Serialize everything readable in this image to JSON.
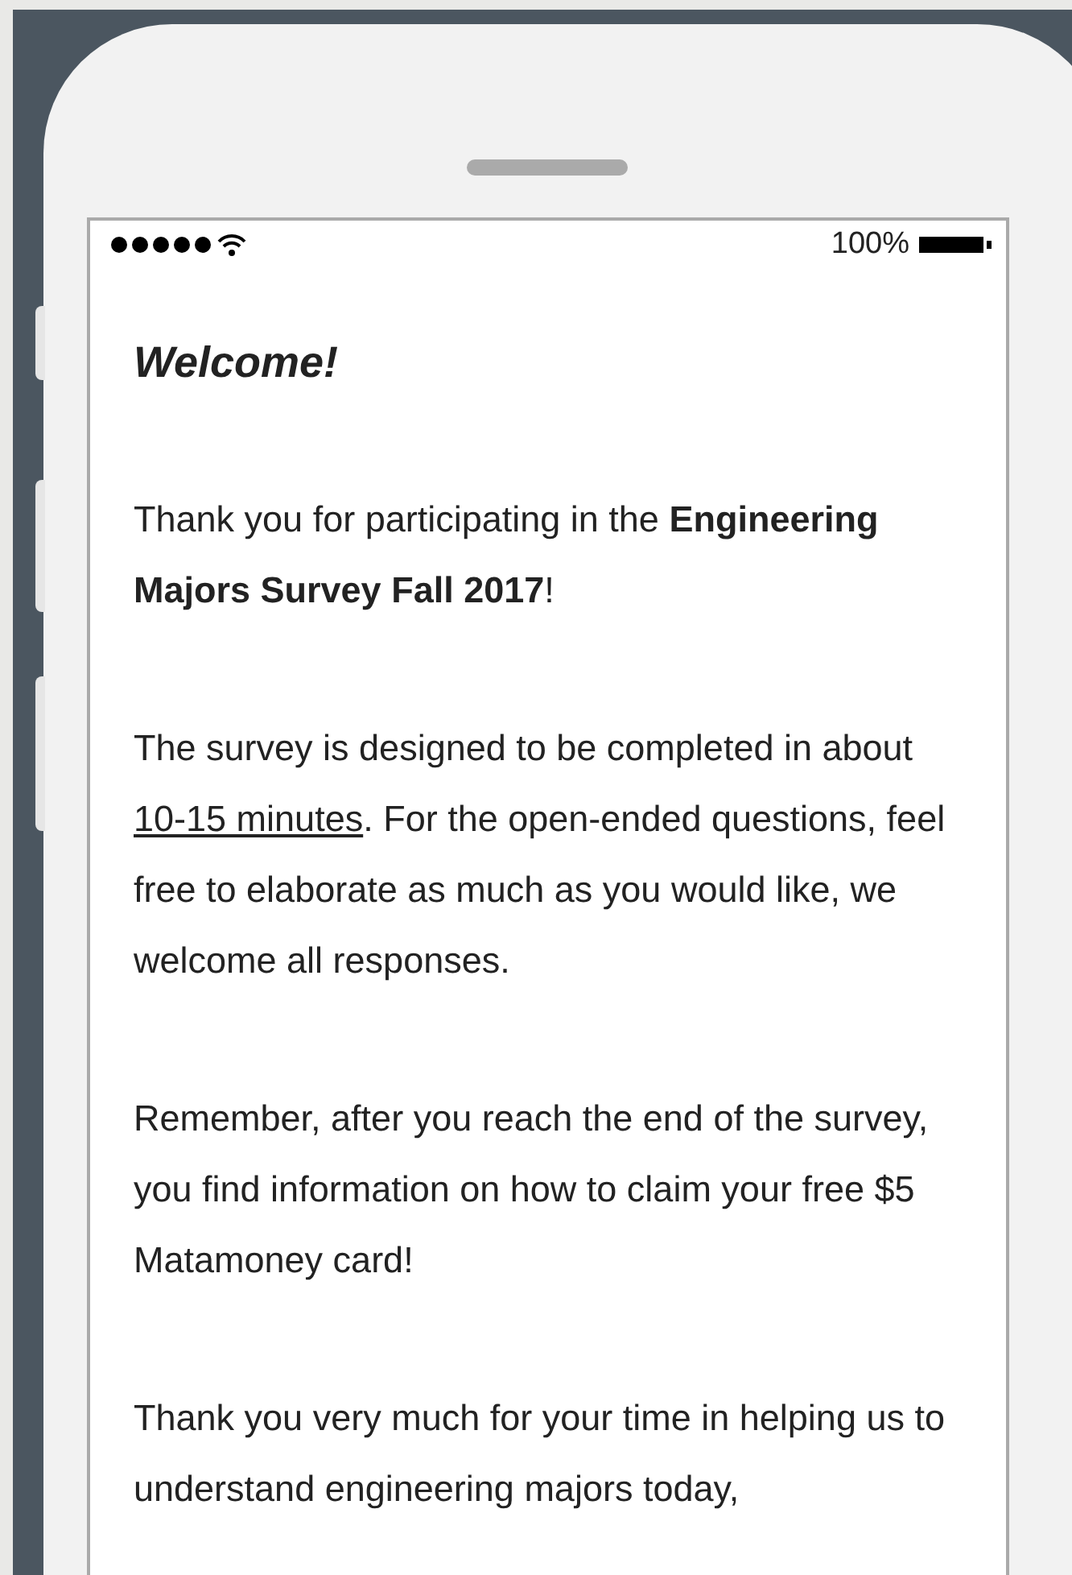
{
  "status_bar": {
    "battery_percent": "100%"
  },
  "title": "Welcome!",
  "paragraphs": [
    {
      "segments": [
        {
          "text": "Thank you for participating in the **Engineering Majors Survey Fall 2017**!",
          "underline": false
        }
      ]
    },
    {
      "segments": [
        {
          "text": "The survey is designed to be completed in about ",
          "underline": false
        },
        {
          "text": "10-15 minutes",
          "underline": true
        },
        {
          "text": ". For the open-ended questions, feel free to elaborate as much as you would like, we welcome all responses.",
          "underline": false
        }
      ]
    },
    {
      "segments": [
        {
          "text": "Remember, after you reach the end of the survey, you find information on how to claim your free $5 Matamoney card!",
          "underline": false
        }
      ]
    },
    {
      "segments": [
        {
          "text": "Thank you very much for your time in helping us to understand engineering majors today,",
          "underline": false
        }
      ]
    }
  ]
}
